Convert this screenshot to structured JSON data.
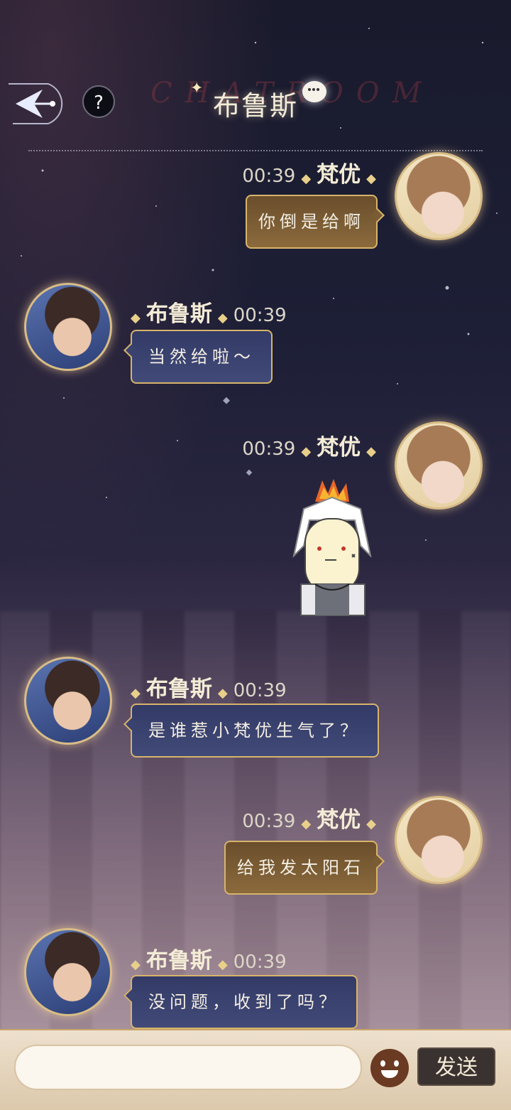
{
  "header": {
    "watermark": "CHATROOM",
    "title": "布鲁斯",
    "help_label": "?"
  },
  "messages": [
    {
      "sender": "梵优",
      "time": "00:39",
      "text": "你倒是给啊",
      "side": "right"
    },
    {
      "sender": "布鲁斯",
      "time": "00:39",
      "text": "当然给啦～",
      "side": "left"
    },
    {
      "sender": "梵优",
      "time": "00:39",
      "text": "",
      "side": "right",
      "sticker": "angry-chibi-sticker"
    },
    {
      "sender": "布鲁斯",
      "time": "00:39",
      "text": "是谁惹小梵优生气了？",
      "side": "left"
    },
    {
      "sender": "梵优",
      "time": "00:39",
      "text": "给我发太阳石",
      "side": "right"
    },
    {
      "sender": "布鲁斯",
      "time": "00:39",
      "text": "没问题，收到了吗？",
      "side": "left"
    }
  ],
  "composer": {
    "input_value": "",
    "send_label": "发送"
  },
  "colors": {
    "accent_gold": "#d8b46b",
    "mine_bubble": "#7a5c34",
    "theirs_bubble": "#3a4270"
  }
}
